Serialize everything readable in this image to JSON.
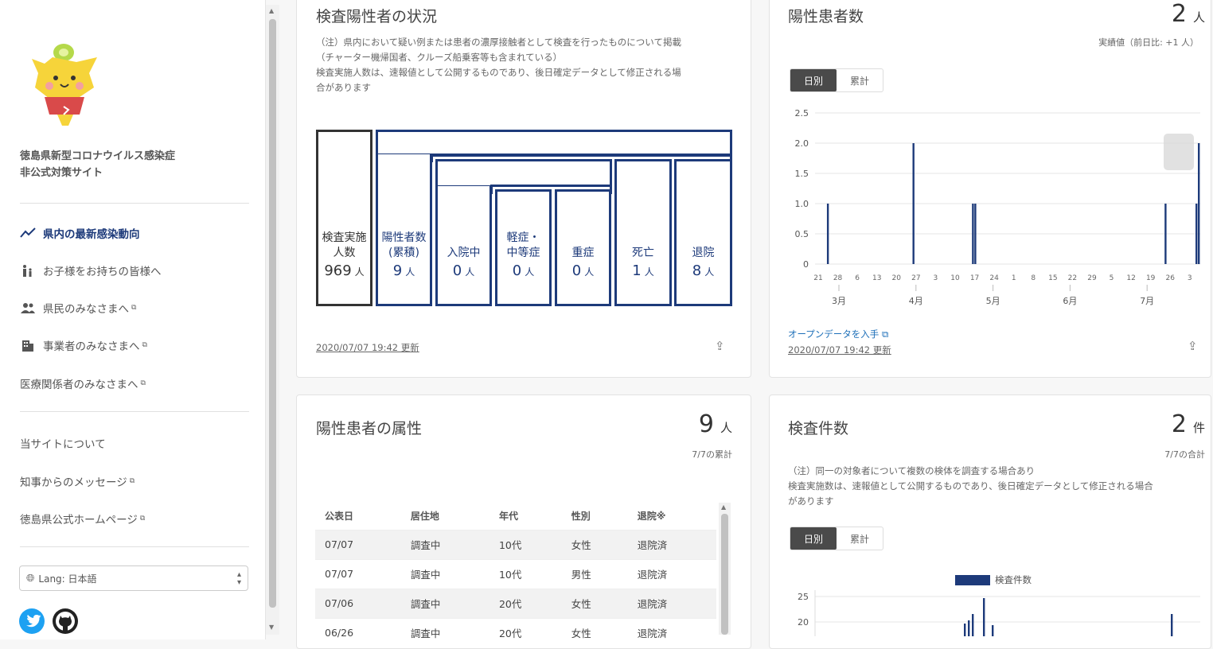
{
  "sidebar": {
    "title_line1": "徳島県新型コロナウイルス感染症",
    "title_line2": "非公式対策サイト",
    "nav": [
      {
        "label": "県内の最新感染動向",
        "icon": "trend-icon"
      },
      {
        "label": "お子様をお持ちの皆様へ",
        "icon": "family-icon"
      },
      {
        "label": "県民のみなさまへ",
        "icon": "people-icon"
      },
      {
        "label": "事業者のみなさまへ",
        "icon": "building-icon"
      },
      {
        "label": "医療関係者のみなさまへ"
      }
    ],
    "links": [
      {
        "label": "当サイトについて"
      },
      {
        "label": "知事からのメッセージ"
      },
      {
        "label": "徳島県公式ホームページ"
      }
    ],
    "lang_label": "Lang: 日本語",
    "social": [
      "twitter-icon",
      "github-icon"
    ]
  },
  "card_testing_status": {
    "title": "検査陽性者の状況",
    "note1": "（注）県内において疑い例または患者の濃厚接触者として検査を行ったものについて掲載",
    "note2": "（チャーター機帰国者、クルーズ船乗客等も含まれている）",
    "note3": "検査実施人数は、速報値として公開するものであり、後日確定データとして修正される場",
    "note4": "合があります",
    "boxes": [
      {
        "l1": "検査実施",
        "l2": "人数",
        "value": "969",
        "unit": "人"
      },
      {
        "l1": "陽性者数",
        "l2": "(累積)",
        "value": "9",
        "unit": "人"
      },
      {
        "l1": "",
        "l2": "入院中",
        "value": "0",
        "unit": "人"
      },
      {
        "l1": "軽症・",
        "l2": "中等症",
        "value": "0",
        "unit": "人"
      },
      {
        "l1": "",
        "l2": "重症",
        "value": "0",
        "unit": "人"
      },
      {
        "l1": "",
        "l2": "死亡",
        "value": "1",
        "unit": "人"
      },
      {
        "l1": "",
        "l2": "退院",
        "value": "8",
        "unit": "人"
      }
    ],
    "updated": "2020/07/07 19:42 更新"
  },
  "card_positive": {
    "title": "陽性患者数",
    "big": "2",
    "unit": "人",
    "sub": "実績値（前日比: +1 人）",
    "toggle": [
      "日別",
      "累計"
    ],
    "open_data": "オープンデータを入手",
    "updated": "2020/07/07 19:42 更新"
  },
  "card_attributes": {
    "title": "陽性患者の属性",
    "big": "9",
    "unit": "人",
    "sub": "7/7の累計",
    "headers": [
      "公表日",
      "居住地",
      "年代",
      "性別",
      "退院※"
    ],
    "rows": [
      [
        "07/07",
        "調査中",
        "10代",
        "女性",
        "退院済"
      ],
      [
        "07/07",
        "調査中",
        "10代",
        "男性",
        "退院済"
      ],
      [
        "07/06",
        "調査中",
        "20代",
        "女性",
        "退院済"
      ],
      [
        "06/26",
        "調査中",
        "20代",
        "女性",
        "退院済"
      ]
    ]
  },
  "card_tests": {
    "title": "検査件数",
    "big": "2",
    "unit": "件",
    "sub": "7/7の合計",
    "note1": "（注）同一の対象者について複数の検体を調査する場合あり",
    "note2": "検査実施数は、速報値として公開するものであり、後日確定データとして修正される場合",
    "note3": "があります",
    "toggle": [
      "日別",
      "累計"
    ],
    "legend": "検査件数"
  },
  "colors": {
    "bar": "#1d3a7a",
    "accent": "#1d3a7a"
  },
  "chart_data": [
    {
      "type": "bar",
      "series": [
        {
          "values": [
            0,
            0,
            0,
            0,
            0,
            1,
            0,
            0,
            0,
            0,
            0,
            0,
            0,
            0,
            0,
            0,
            0,
            0,
            0,
            0,
            0,
            0,
            0,
            0,
            0,
            0,
            0,
            0,
            0,
            0,
            0,
            0,
            0,
            0,
            0,
            0,
            0,
            0,
            0,
            0,
            0,
            2,
            0,
            0,
            0,
            0,
            0,
            0,
            0,
            0,
            0,
            0,
            0,
            0,
            0,
            0,
            0,
            0,
            0,
            0,
            0,
            0,
            0,
            0,
            0,
            0,
            1,
            1,
            0,
            0,
            0,
            0,
            0,
            0,
            0,
            0,
            0,
            0,
            0,
            0,
            0,
            0,
            0,
            0,
            0,
            0,
            0,
            0,
            0,
            0,
            0,
            0,
            0,
            0,
            0,
            0,
            0,
            0,
            0,
            0,
            0,
            0,
            0,
            0,
            0,
            0,
            0,
            0,
            0,
            0,
            0,
            0,
            0,
            0,
            0,
            0,
            0,
            0,
            0,
            0,
            0,
            0,
            0,
            0,
            0,
            0,
            0,
            0,
            0,
            0,
            0,
            0,
            0,
            0,
            0,
            0,
            0,
            0,
            0,
            0,
            0,
            0,
            0,
            0,
            0,
            0,
            0,
            1,
            0,
            0,
            0,
            0,
            0,
            0,
            0,
            0,
            0,
            0,
            0,
            0,
            1,
            2
          ]
        }
      ],
      "ylim": [
        0,
        2.5
      ],
      "yticks": [
        "0",
        "0.5",
        "1.0",
        "1.5",
        "2.0",
        "2.5"
      ],
      "xticks": [
        "21",
        "28",
        "6",
        "13",
        "20",
        "27",
        "3",
        "10",
        "17",
        "24",
        "1",
        "8",
        "15",
        "22",
        "29",
        "5",
        "12",
        "19",
        "26",
        "3"
      ],
      "months": [
        "3月",
        "4月",
        "5月",
        "6月",
        "7月"
      ]
    },
    {
      "type": "bar",
      "series": [
        {
          "name": "検査件数"
        }
      ],
      "ylim": [
        0,
        25
      ],
      "yticks": [
        "20",
        "25"
      ]
    }
  ]
}
